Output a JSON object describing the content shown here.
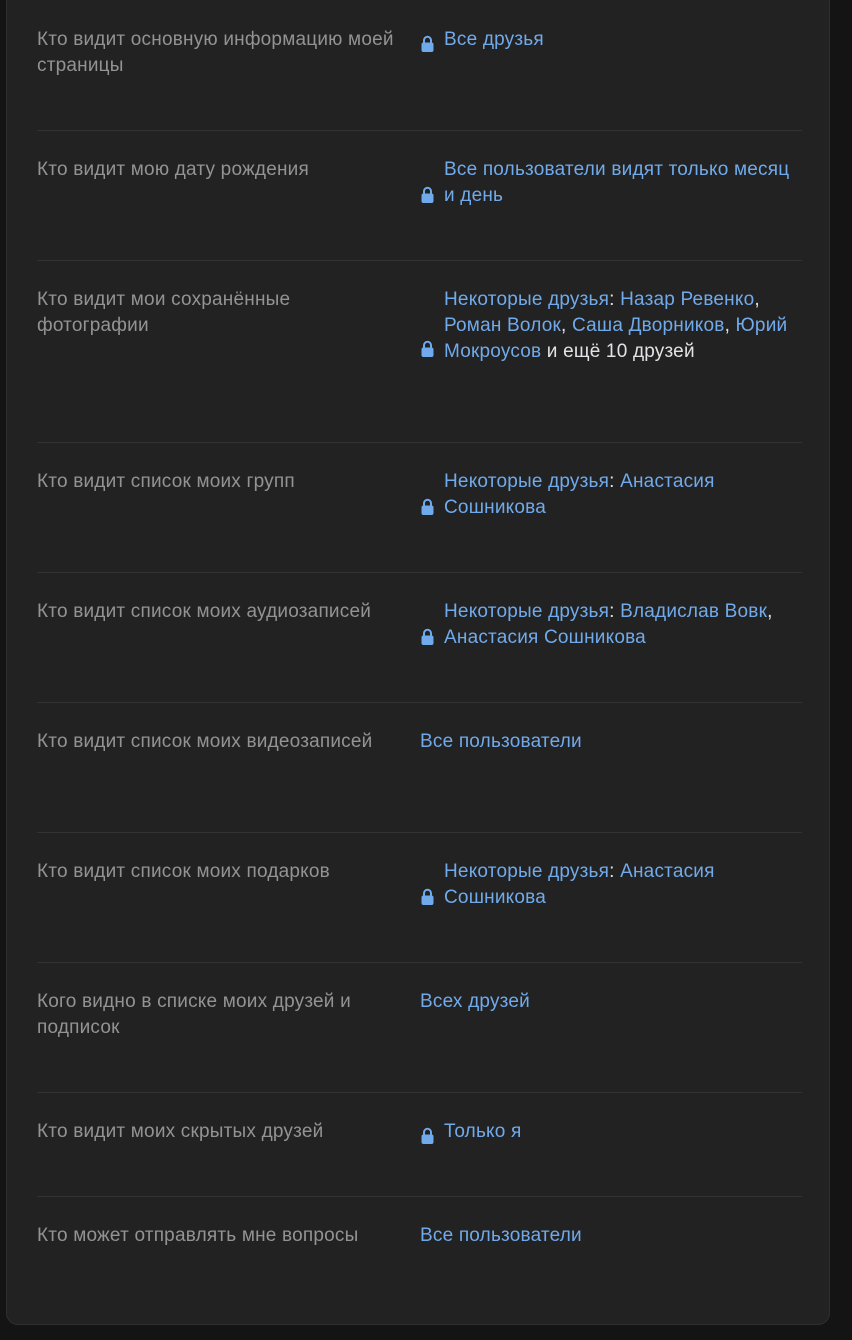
{
  "settings": [
    {
      "label": "Кто видит основную информацию моей страницы",
      "locked": true,
      "prefix": "",
      "links": [
        "Все друзья"
      ],
      "suffix_plain": ""
    },
    {
      "label": "Кто видит мою дату рождения",
      "locked": true,
      "prefix": "",
      "links": [
        "Все пользователи видят только месяц и день"
      ],
      "suffix_plain": ""
    },
    {
      "label": "Кто видит мои сохранённые фотографии",
      "locked": true,
      "prefix": "Некоторые друзья",
      "links": [
        "Назар Ревенко",
        "Роман Волок",
        "Саша Дворников",
        "Юрий Мокроусов"
      ],
      "suffix_plain": "и ещё 10 друзей"
    },
    {
      "label": "Кто видит список моих групп",
      "locked": true,
      "prefix": "Некоторые друзья",
      "links": [
        "Анастасия Сошникова"
      ],
      "suffix_plain": ""
    },
    {
      "label": "Кто видит список моих аудиозаписей",
      "locked": true,
      "prefix": "Некоторые друзья",
      "links": [
        "Владислав Вовк",
        "Анастасия Сошникова"
      ],
      "suffix_plain": ""
    },
    {
      "label": "Кто видит список моих видеозаписей",
      "locked": false,
      "prefix": "",
      "links": [
        "Все пользователи"
      ],
      "suffix_plain": ""
    },
    {
      "label": "Кто видит список моих подарков",
      "locked": true,
      "prefix": "Некоторые друзья",
      "links": [
        "Анастасия Сошникова"
      ],
      "suffix_plain": ""
    },
    {
      "label": "Кого видно в списке моих друзей и подписок",
      "locked": false,
      "prefix": "",
      "links": [
        "Всех друзей"
      ],
      "suffix_plain": ""
    },
    {
      "label": "Кто видит моих скрытых друзей",
      "locked": true,
      "prefix": "",
      "links": [
        "Только я"
      ],
      "suffix_plain": ""
    },
    {
      "label": "Кто может отправлять мне вопросы",
      "locked": false,
      "prefix": "",
      "links": [
        "Все пользователи"
      ],
      "suffix_plain": ""
    }
  ],
  "icons": {
    "lock": "lock-icon",
    "lock_color": "#71aaeb"
  },
  "colors": {
    "background": "#141414",
    "card": "#222222",
    "label": "#939393",
    "link": "#71aaeb",
    "text": "#e1e3e6",
    "separator": "#333333"
  }
}
